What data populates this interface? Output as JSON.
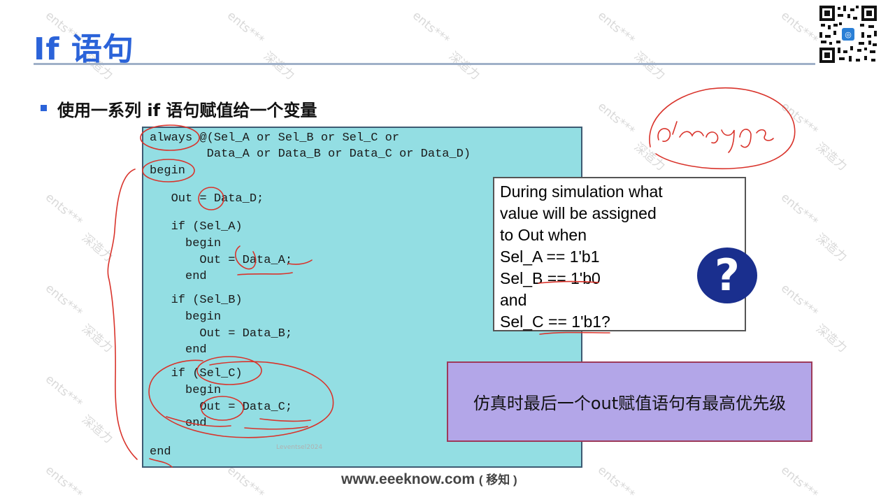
{
  "slide": {
    "title": "If 语句",
    "bullet": "使用一系列 if 语句赋值给一个变量"
  },
  "code": {
    "lines": [
      "always @(Sel_A or Sel_B or Sel_C or",
      "        Data_A or Data_B or Data_C or Data_D)",
      "begin",
      "   Out = Data_D;",
      "   if (Sel_A)",
      "     begin",
      "       Out = Data_A;",
      "     end",
      "   if (Sel_B)",
      "     begin",
      "       Out = Data_B;",
      "     end",
      "   if (Sel_C)",
      "     begin",
      "       Out = Data_C;",
      "     end",
      "end"
    ],
    "inner_watermark": "Leventsel2024"
  },
  "question_box": {
    "lines": [
      "During simulation what",
      "value will be assigned",
      "to Out when",
      "Sel_A == 1'b1",
      "Sel_B == 1'b0",
      "and",
      "Sel_C == 1'b1?"
    ],
    "icon_glyph": "?"
  },
  "note": "仿真时最后一个out赋值语句有最高优先级",
  "handwriting": "always",
  "footer": {
    "site": "www.eeeknow.com",
    "cn": "( 移知 )"
  },
  "watermark_text": [
    "ents***",
    "深造力"
  ],
  "icons": [
    "qr-code-icon",
    "question-mark-icon"
  ],
  "colors": {
    "title": "#2b63d9",
    "code_background": "#93dee3",
    "note_background": "#b3a6e8",
    "ink": "#d9332b",
    "question_icon": "#1a2f8e"
  }
}
